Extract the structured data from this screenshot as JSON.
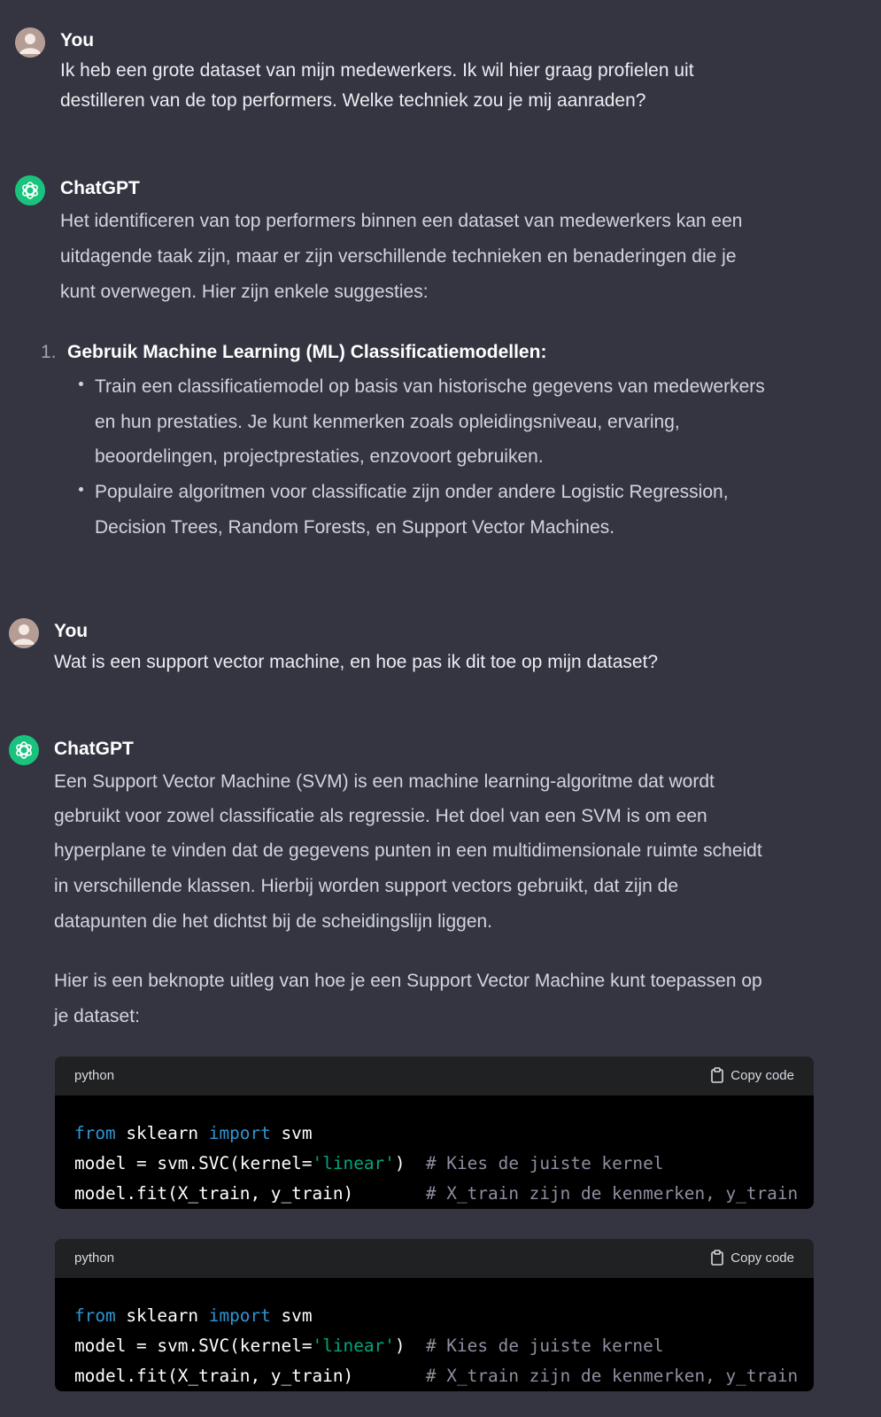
{
  "messages": [
    {
      "author": "You",
      "text_lines": [
        "Ik heb een grote dataset van mijn medewerkers. Ik wil hier graag profielen uit",
        "destilleren van de top performers. Welke techniek zou je mij aanraden?"
      ]
    },
    {
      "author": "ChatGPT",
      "intro_lines": [
        "Het identificeren van top performers binnen een dataset van medewerkers kan een",
        "uitdagende taak zijn, maar er zijn verschillende technieken en benaderingen die je",
        "kunt overwegen. Hier zijn enkele suggesties:"
      ],
      "list": {
        "number": "1.",
        "title": "Gebruik Machine Learning (ML) Classificatiemodellen:",
        "bullets": [
          [
            "Train een classificatiemodel op basis van historische gegevens van medewerkers",
            "en hun prestaties. Je kunt kenmerken zoals opleidingsniveau, ervaring,",
            "beoordelingen, projectprestaties, enzovoort gebruiken."
          ],
          [
            "Populaire algoritmen voor classificatie zijn onder andere Logistic Regression,",
            "Decision Trees, Random Forests, en Support Vector Machines."
          ]
        ]
      }
    },
    {
      "author": "You",
      "text_lines": [
        "Wat is een support vector machine, en hoe pas ik dit toe op mijn dataset?"
      ]
    },
    {
      "author": "ChatGPT",
      "para1_lines": [
        "Een Support Vector Machine (SVM) is een machine learning-algoritme dat wordt",
        "gebruikt voor zowel classificatie als regressie. Het doel van een SVM is om een",
        "hyperplane te vinden dat de gegevens punten in een multidimensionale ruimte scheidt",
        "in verschillende klassen. Hierbij worden support vectors gebruikt, dat zijn de",
        "datapunten die het dichtst bij de scheidingslijn liggen."
      ],
      "para2_lines": [
        "Hier is een beknopte uitleg van hoe je een Support Vector Machine kunt toepassen op",
        "je dataset:"
      ],
      "code_blocks": [
        {
          "language": "python",
          "copy_label": "Copy code",
          "lines": [
            [
              {
                "t": "from",
                "c": "kw"
              },
              {
                "t": " sklearn ",
                "c": ""
              },
              {
                "t": "import",
                "c": "kw"
              },
              {
                "t": " svm",
                "c": ""
              }
            ],
            [
              {
                "t": "model = svm.SVC(kernel=",
                "c": ""
              },
              {
                "t": "'linear'",
                "c": "str"
              },
              {
                "t": ")  ",
                "c": ""
              },
              {
                "t": "# Kies de juiste kernel",
                "c": "cm"
              }
            ],
            [
              {
                "t": "model.fit(X_train, y_train)       ",
                "c": ""
              },
              {
                "t": "# X_train zijn de kenmerken, y_train",
                "c": "cm"
              }
            ]
          ]
        },
        {
          "language": "python",
          "copy_label": "Copy code",
          "lines": [
            [
              {
                "t": "from",
                "c": "kw"
              },
              {
                "t": " sklearn ",
                "c": ""
              },
              {
                "t": "import",
                "c": "kw"
              },
              {
                "t": " svm",
                "c": ""
              }
            ],
            [
              {
                "t": "model = svm.SVC(kernel=",
                "c": ""
              },
              {
                "t": "'linear'",
                "c": "str"
              },
              {
                "t": ")  ",
                "c": ""
              },
              {
                "t": "# Kies de juiste kernel",
                "c": "cm"
              }
            ],
            [
              {
                "t": "model.fit(X_train, y_train)       ",
                "c": ""
              },
              {
                "t": "# X_train zijn de kenmerken, y_train",
                "c": "cm"
              }
            ]
          ]
        }
      ]
    }
  ],
  "colors": {
    "background": "#343541",
    "code_header": "#202123",
    "code_body": "#000000",
    "gpt_avatar": "#19c37d",
    "user_avatar": "#b59c95",
    "keyword": "#2e95d3",
    "string": "#00a67d",
    "comment": "#8e8ea0"
  },
  "icons": {
    "user_avatar": "user-avatar-icon",
    "gpt_avatar": "openai-logo-icon",
    "copy": "clipboard-icon"
  }
}
